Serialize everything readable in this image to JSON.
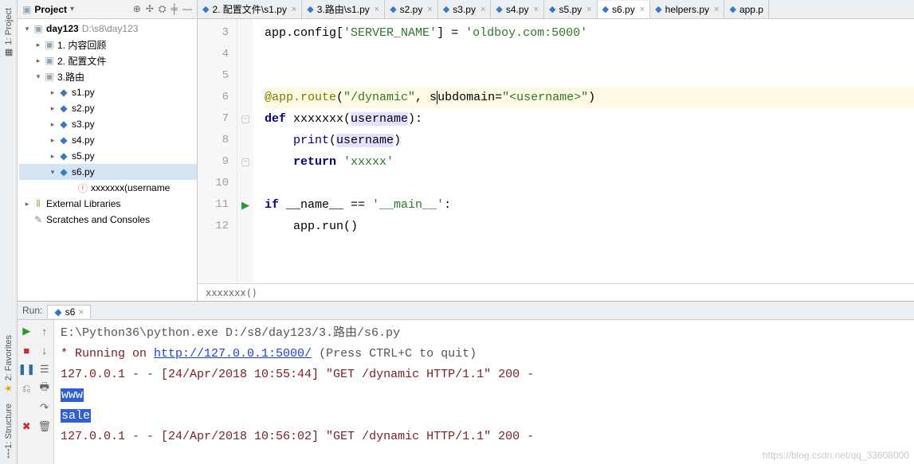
{
  "left_tabs": {
    "project": "1: Project",
    "favorites": "2: Favorites",
    "structure": "1: Structure"
  },
  "project_panel": {
    "title": "Project",
    "root": {
      "name": "day123",
      "path": "D:\\s8\\day123"
    },
    "folders": [
      "1. 内容回顾",
      "2. 配置文件",
      "3.路由"
    ],
    "files": [
      "s1.py",
      "s2.py",
      "s3.py",
      "s4.py",
      "s5.py",
      "s6.py"
    ],
    "fn": "xxxxxxx(username",
    "ext_lib": "External Libraries",
    "scratches": "Scratches and Consoles"
  },
  "tabs": [
    {
      "label": "2. 配置文件\\s1.py"
    },
    {
      "label": "3.路由\\s1.py"
    },
    {
      "label": "s2.py"
    },
    {
      "label": "s3.py"
    },
    {
      "label": "s4.py"
    },
    {
      "label": "s5.py"
    },
    {
      "label": "s6.py",
      "active": true
    },
    {
      "label": "helpers.py"
    },
    {
      "label": "app.p"
    }
  ],
  "editor": {
    "line_start": 3,
    "lines": {
      "3": "app.config['SERVER_NAME'] = 'oldboy.com:5000'",
      "4": "",
      "5": "",
      "6": "@app.route(\"/dynamic\", subdomain=\"<username>\")",
      "7": "def xxxxxxx(username):",
      "8": "    print(username)",
      "9": "    return 'xxxxx'",
      "10": "",
      "11": "if __name__ == '__main__':",
      "12": "    app.run()"
    },
    "breadcrumb": "xxxxxxx()"
  },
  "run": {
    "title": "Run:",
    "tab": "s6",
    "cmd": "E:\\Python36\\python.exe D:/s8/day123/3.路由/s6.py",
    "running_prefix": " * Running on ",
    "running_link": "http://127.0.0.1:5000/",
    "running_suffix": " (Press CTRL+C to quit)",
    "log1": "127.0.0.1 - - [24/Apr/2018 10:55:44] \"GET /dynamic HTTP/1.1\" 200 -",
    "out1": "www",
    "out2": "sale",
    "log2": "127.0.0.1 - - [24/Apr/2018 10:56:02] \"GET /dynamic HTTP/1.1\" 200 -"
  },
  "watermark": "https://blog.csdn.net/qq_33608000"
}
